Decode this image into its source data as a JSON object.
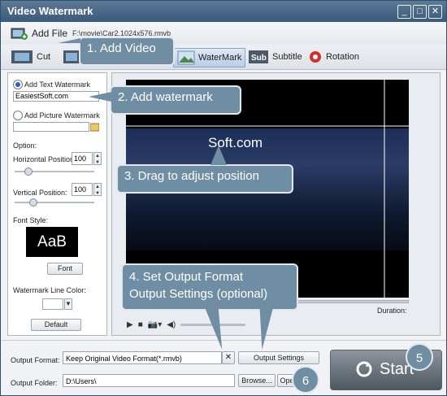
{
  "window": {
    "title": "Video Watermark",
    "controls": [
      "_",
      "□",
      "✕"
    ]
  },
  "toolbar": {
    "add_file": "Add File",
    "path": "F:\\movie\\Car2.1024x576.rmvb"
  },
  "tabs": [
    "Cut",
    "",
    "WaterMark",
    "Subtitle",
    "Rotation"
  ],
  "left": {
    "add_text": "Add Text Watermark",
    "text_value": "EasiestSoft.com",
    "add_picture": "Add Picture Watermark",
    "option": "Option:",
    "h_pos_label": "Horizontal Position:",
    "h_pos_value": "100",
    "v_pos_label": "Vertical Position:",
    "v_pos_value": "100",
    "font_style": "Font Style:",
    "font_sample": "AaB",
    "font_button": "Font",
    "line_color": "Watermark Line Color:",
    "default_button": "Default"
  },
  "preview": {
    "watermark": "Soft.com",
    "duration_label": "Duration:"
  },
  "bottom": {
    "output_format_label": "Output Format:",
    "output_format_value": "Keep Original Video Format(*.rmvb)",
    "output_settings": "Output Settings",
    "output_folder_label": "Output Folder:",
    "output_folder_value": "D:\\Users\\",
    "browse": "Browse...",
    "open": "Ope",
    "start": "Start"
  },
  "callouts": {
    "c1": "1. Add Video",
    "c2": "2. Add watermark",
    "c3": "3. Drag to adjust position",
    "c4_line1": "4. Set Output Format",
    "c4_line2": "Output Settings (optional)",
    "c5": "5",
    "c6": "6"
  }
}
